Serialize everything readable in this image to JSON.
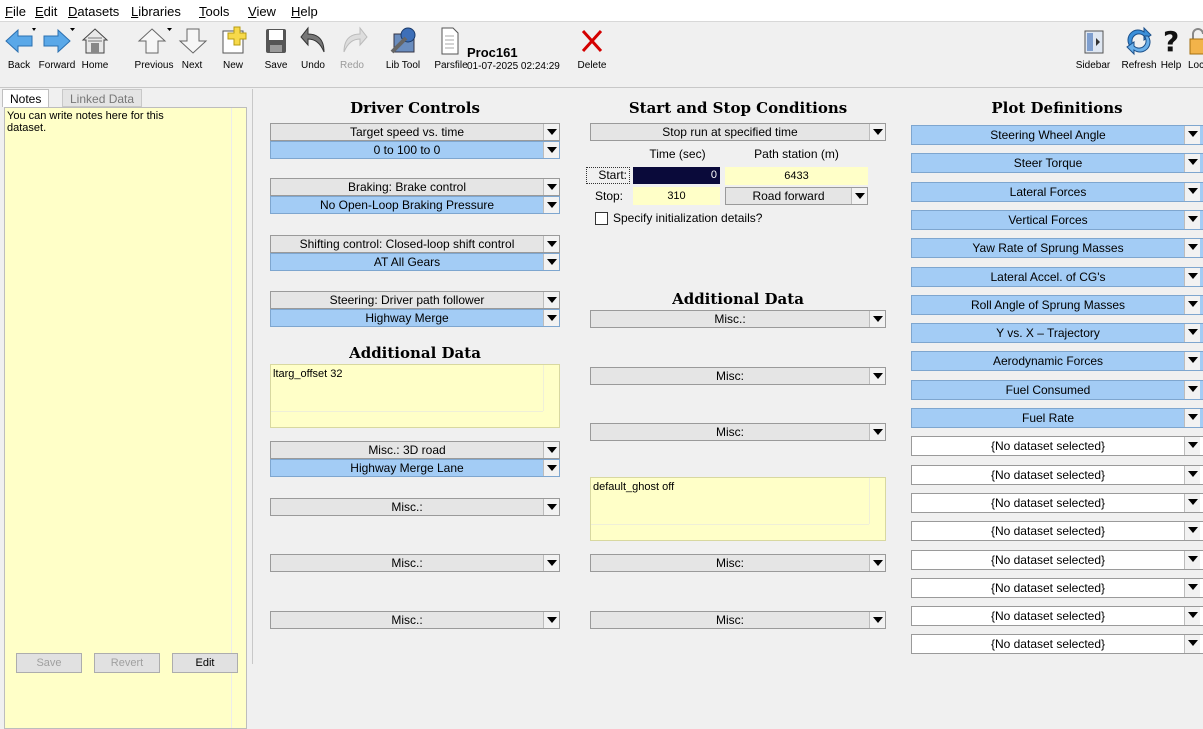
{
  "menu": [
    "File",
    "Edit",
    "Datasets",
    "Libraries",
    "Tools",
    "View",
    "Help"
  ],
  "toolbar": {
    "back": "Back",
    "forward": "Forward",
    "home": "Home",
    "previous": "Previous",
    "next": "Next",
    "new": "New",
    "save": "Save",
    "undo": "Undo",
    "redo": "Redo",
    "libtool": "Lib Tool",
    "parsfile": "Parsfile",
    "dataset_name": "Proc161",
    "dataset_date": "01-07-2025 02:24:29",
    "delete": "Delete",
    "sidebar": "Sidebar",
    "refresh": "Refresh",
    "help": "Help",
    "lock": "Loc"
  },
  "left": {
    "tab_notes": "Notes",
    "tab_linked": "Linked Data",
    "notes_text": "You can write notes here for this dataset.",
    "save": "Save",
    "revert": "Revert",
    "edit": "Edit"
  },
  "driver": {
    "title": "Driver Controls",
    "speed_type": "Target speed vs. time",
    "speed_value": "0 to 100 to 0",
    "braking_type": "Braking: Brake control",
    "braking_value": "No Open-Loop Braking Pressure",
    "shift_type": "Shifting control: Closed-loop shift control",
    "shift_value": "AT All Gears",
    "steer_type": "Steering: Driver path follower",
    "steer_value": "Highway Merge",
    "additional_title": "Additional Data",
    "additional_text": "ltarg_offset 32",
    "misc3d_type": "Misc.: 3D road",
    "misc3d_value": "Highway Merge Lane",
    "misc1": "Misc.:",
    "misc2": "Misc.:",
    "misc3": "Misc.:"
  },
  "startstop": {
    "title": "Start and Stop Conditions",
    "stop_mode": "Stop run at specified time",
    "col_time": "Time (sec)",
    "col_station": "Path station (m)",
    "start_label": "Start:",
    "start_time": "0",
    "start_station": "6433",
    "stop_label": "Stop:",
    "stop_time": "310",
    "stop_direction": "Road forward",
    "init_label": "Specify initialization details?",
    "additional_title": "Additional Data",
    "misc1": "Misc.:",
    "misc2": "Misc:",
    "misc3": "Misc:",
    "additional_text": "default_ghost off",
    "misc4": "Misc:",
    "misc5": "Misc:"
  },
  "plots": {
    "title": "Plot Definitions",
    "items": [
      "Steering Wheel Angle",
      "Steer Torque",
      "Lateral Forces",
      "Vertical Forces",
      "Yaw Rate of Sprung Masses",
      "Lateral Accel. of CG's",
      "Roll Angle of Sprung Masses",
      "Y vs. X – Trajectory",
      "Aerodynamic Forces",
      "Fuel Consumed",
      "Fuel Rate",
      "{No dataset selected}",
      "{No dataset selected}",
      "{No dataset selected}",
      "{No dataset selected}",
      "{No dataset selected}",
      "{No dataset selected}",
      "{No dataset selected}",
      "{No dataset selected}"
    ]
  },
  "colors": {
    "selected": "#a3ccf5",
    "notes_bg": "#ffffc8",
    "delete": "#d40000"
  },
  "icons": [
    "back-arrow-icon",
    "forward-arrow-icon",
    "home-icon",
    "previous-arrow-icon",
    "next-arrow-icon",
    "new-dataset-icon",
    "save-disk-icon",
    "undo-icon",
    "redo-icon",
    "lib-tool-icon",
    "parsfile-icon",
    "delete-x-icon",
    "sidebar-icon",
    "refresh-icon",
    "help-icon",
    "lock-icon"
  ]
}
